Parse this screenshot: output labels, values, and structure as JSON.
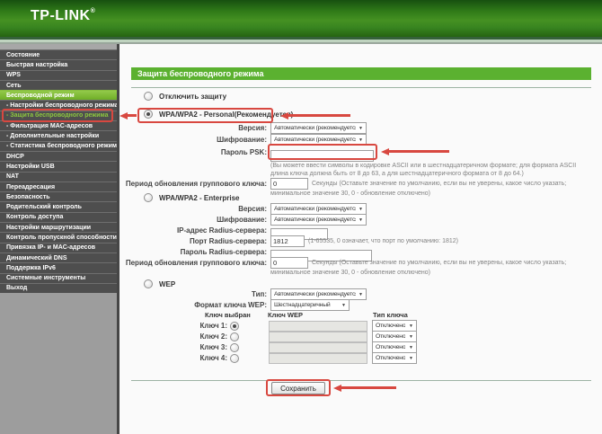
{
  "brand": {
    "logo": "TP-LINK",
    "reg": "®"
  },
  "icons": {
    "dropdown_caret": "▼"
  },
  "colors": {
    "accent_green": "#5bb130",
    "sidebar_active_green": "#7db52e",
    "submenu_highlight": "#8dc63f",
    "annotation_red": "#d84840"
  },
  "sidebar": {
    "items": [
      {
        "label": "Состояние"
      },
      {
        "label": "Быстрая настройка"
      },
      {
        "label": "WPS"
      },
      {
        "label": "Сеть"
      },
      {
        "label": "Беспроводной режим"
      },
      {
        "label": "- Настройки беспроводного режима"
      },
      {
        "label": "- Защита беспроводного режима"
      },
      {
        "label": "- Фильтрация MAC-адресов"
      },
      {
        "label": "- Дополнительные настройки"
      },
      {
        "label": "- Статистика беспроводного режима"
      },
      {
        "label": "DHCP"
      },
      {
        "label": "Настройки USB"
      },
      {
        "label": "NAT"
      },
      {
        "label": "Переадресация"
      },
      {
        "label": "Безопасность"
      },
      {
        "label": "Родительский контроль"
      },
      {
        "label": "Контроль доступа"
      },
      {
        "label": "Настройки маршрутизации"
      },
      {
        "label": "Контроль пропускной способности"
      },
      {
        "label": "Привязка IP- и MAC-адресов"
      },
      {
        "label": "Динамический DNS"
      },
      {
        "label": "Поддержка IPv6"
      },
      {
        "label": "Системные инструменты"
      },
      {
        "label": "Выход"
      }
    ]
  },
  "page": {
    "title": "Защита беспроводного режима"
  },
  "security": {
    "disable": {
      "radio_label": "Отключить защиту"
    },
    "personal": {
      "radio_label": "WPA/WPA2 - Personal(Рекомендуется)",
      "version_label": "Версия:",
      "version_value": "Автоматически (рекомендуется)",
      "encryption_label": "Шифрование:",
      "encryption_value": "Автоматически (рекомендуется)",
      "psk_label": "Пароль PSK:",
      "psk_value": "",
      "psk_note_line1": "(Вы можете ввести символы в кодировке ASCII или в шестнадцатеричном формате; для формата ASCII",
      "psk_note_line2": "длина ключа должна быть от 8 до 63, а для шестнадцатеричного формата от 8 до 64.)",
      "group_label": "Период обновления группового ключа:",
      "group_value": "0",
      "group_note_line1": "Секунды (Оставьте значение по умолчанию, если вы не уверены, какое число указать;",
      "group_note_line2": "минимальное значение 30, 0 - обновление отключено)"
    },
    "enterprise": {
      "radio_label": "WPA/WPA2 - Enterprise",
      "version_label": "Версия:",
      "version_value": "Автоматически (рекомендуется)",
      "encryption_label": "Шифрование:",
      "encryption_value": "Автоматически (рекомендуется)",
      "radius_ip_label": "IP-адрес Radius-сервера:",
      "radius_ip_value": "",
      "radius_port_label": "Порт Radius-сервера:",
      "radius_port_value": "1812",
      "radius_port_note": "(1-65535, 0 означает, что порт по умолчанию: 1812)",
      "radius_pwd_label": "Пароль Radius-сервера:",
      "radius_pwd_value": "",
      "group_label": "Период обновления группового ключа:",
      "group_value": "0",
      "group_note_line1": "Секунды (Оставьте значение по умолчанию, если вы не уверены, какое число указать;",
      "group_note_line2": "минимальное значение 30, 0 - обновление отключено)"
    },
    "wep": {
      "radio_label": "WEP",
      "type_label": "Тип:",
      "type_value": "Автоматически (рекомендуется)",
      "format_label": "Формат ключа WEP:",
      "format_value": "Шестнадцатеричный",
      "col_selected": "Ключ выбран",
      "col_key": "Ключ WEP",
      "col_type": "Тип ключа",
      "keys": [
        {
          "label": "Ключ 1:",
          "type_value": "Отключено"
        },
        {
          "label": "Ключ 2:",
          "type_value": "Отключено"
        },
        {
          "label": "Ключ 3:",
          "type_value": "Отключено"
        },
        {
          "label": "Ключ 4:",
          "type_value": "Отключено"
        }
      ]
    }
  },
  "actions": {
    "save_label": "Сохранить"
  }
}
